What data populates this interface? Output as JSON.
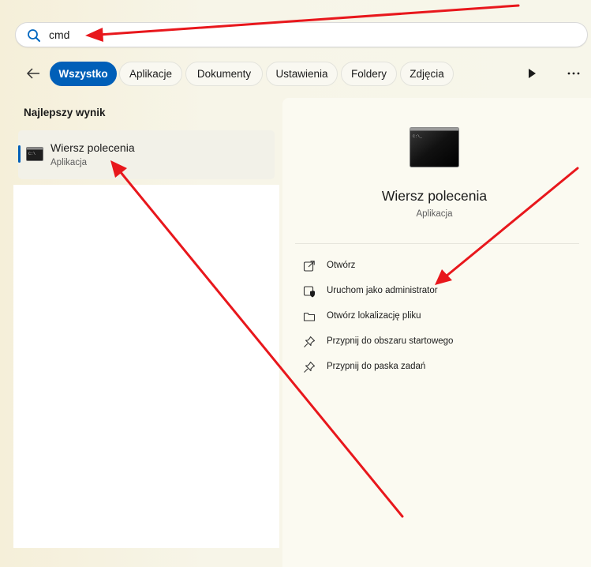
{
  "search": {
    "value": "cmd"
  },
  "filters": [
    {
      "label": "Wszystko",
      "active": true
    },
    {
      "label": "Aplikacje"
    },
    {
      "label": "Dokumenty"
    },
    {
      "label": "Ustawienia"
    },
    {
      "label": "Foldery"
    },
    {
      "label": "Zdjęcia"
    }
  ],
  "left": {
    "section_title": "Najlepszy wynik",
    "best_result": {
      "name": "Wiersz polecenia",
      "type": "Aplikacja"
    }
  },
  "right": {
    "app_name": "Wiersz polecenia",
    "app_type": "Aplikacja",
    "actions": [
      {
        "label": "Otwórz",
        "icon": "open-external-icon"
      },
      {
        "label": "Uruchom jako administrator",
        "icon": "shield-icon"
      },
      {
        "label": "Otwórz lokalizację pliku",
        "icon": "folder-icon"
      },
      {
        "label": "Przypnij do obszaru startowego",
        "icon": "pin-icon"
      },
      {
        "label": "Przypnij do paska zadań",
        "icon": "pin-icon"
      }
    ]
  },
  "colors": {
    "accent": "#005fb8",
    "annotation": "#e8171c"
  }
}
